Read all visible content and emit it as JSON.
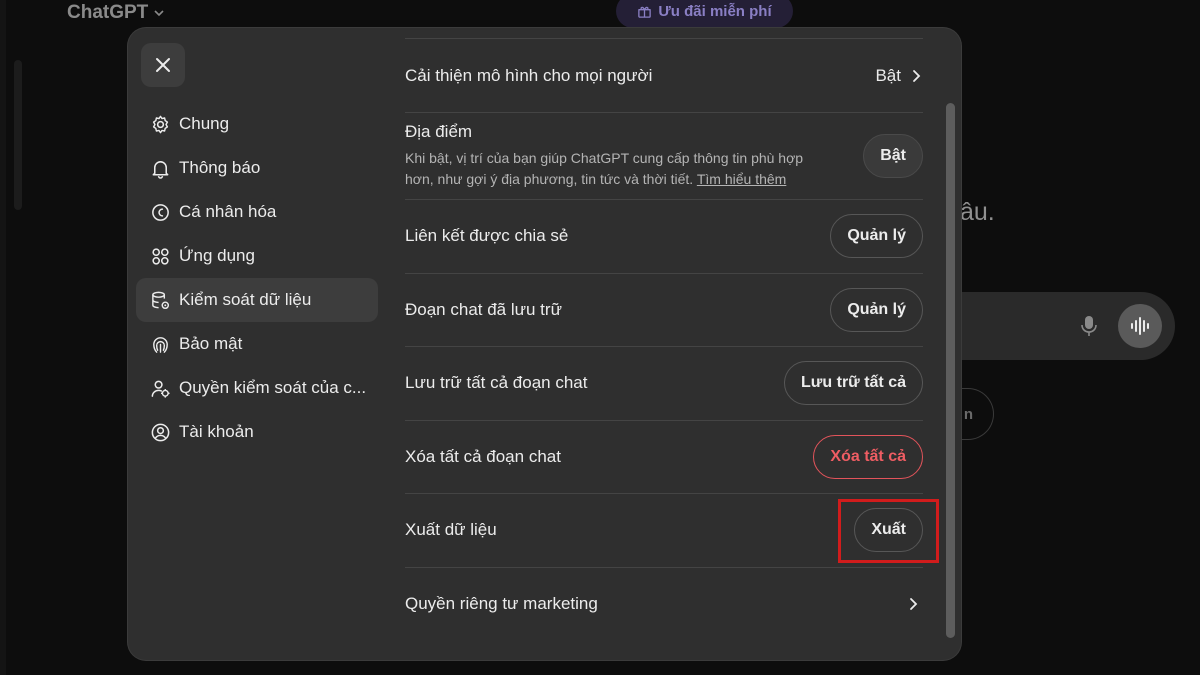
{
  "background": {
    "app_title": "ChatGPT",
    "promo_label": "Ưu đãi miễn phí",
    "heading_fragment": "âu.",
    "pill_fragment": "n"
  },
  "sidebar": {
    "items": [
      {
        "label": "Chung",
        "icon": "gear-icon"
      },
      {
        "label": "Thông báo",
        "icon": "bell-icon"
      },
      {
        "label": "Cá nhân hóa",
        "icon": "personalization-icon"
      },
      {
        "label": "Ứng dụng",
        "icon": "apps-grid-icon"
      },
      {
        "label": "Kiểm soát dữ liệu",
        "icon": "database-settings-icon",
        "active": true
      },
      {
        "label": "Bảo mật",
        "icon": "security-icon"
      },
      {
        "label": "Quyền kiểm soát của c...",
        "icon": "user-controls-icon"
      },
      {
        "label": "Tài khoản",
        "icon": "account-icon"
      }
    ]
  },
  "settings": {
    "improve_model": {
      "label": "Cải thiện mô hình cho mọi người",
      "value": "Bật"
    },
    "location": {
      "title": "Địa điểm",
      "description": "Khi bật, vị trí của bạn giúp ChatGPT cung cấp thông tin phù hợp hơn, như gợi ý địa phương, tin tức và thời tiết.",
      "learn_more": "Tìm hiểu thêm",
      "button": "Bật"
    },
    "shared_links": {
      "label": "Liên kết được chia sẻ",
      "button": "Quản lý"
    },
    "archived_chats": {
      "label": "Đoạn chat đã lưu trữ",
      "button": "Quản lý"
    },
    "archive_all": {
      "label": "Lưu trữ tất cả đoạn chat",
      "button": "Lưu trữ tất cả"
    },
    "delete_all": {
      "label": "Xóa tất cả đoạn chat",
      "button": "Xóa tất cả"
    },
    "export_data": {
      "label": "Xuất dữ liệu",
      "button": "Xuất"
    },
    "marketing_privacy": {
      "label": "Quyền riêng tư marketing"
    }
  },
  "colors": {
    "danger": "#ef5d63",
    "highlight": "#d11c1c",
    "modal_bg": "#2f2f2f"
  }
}
